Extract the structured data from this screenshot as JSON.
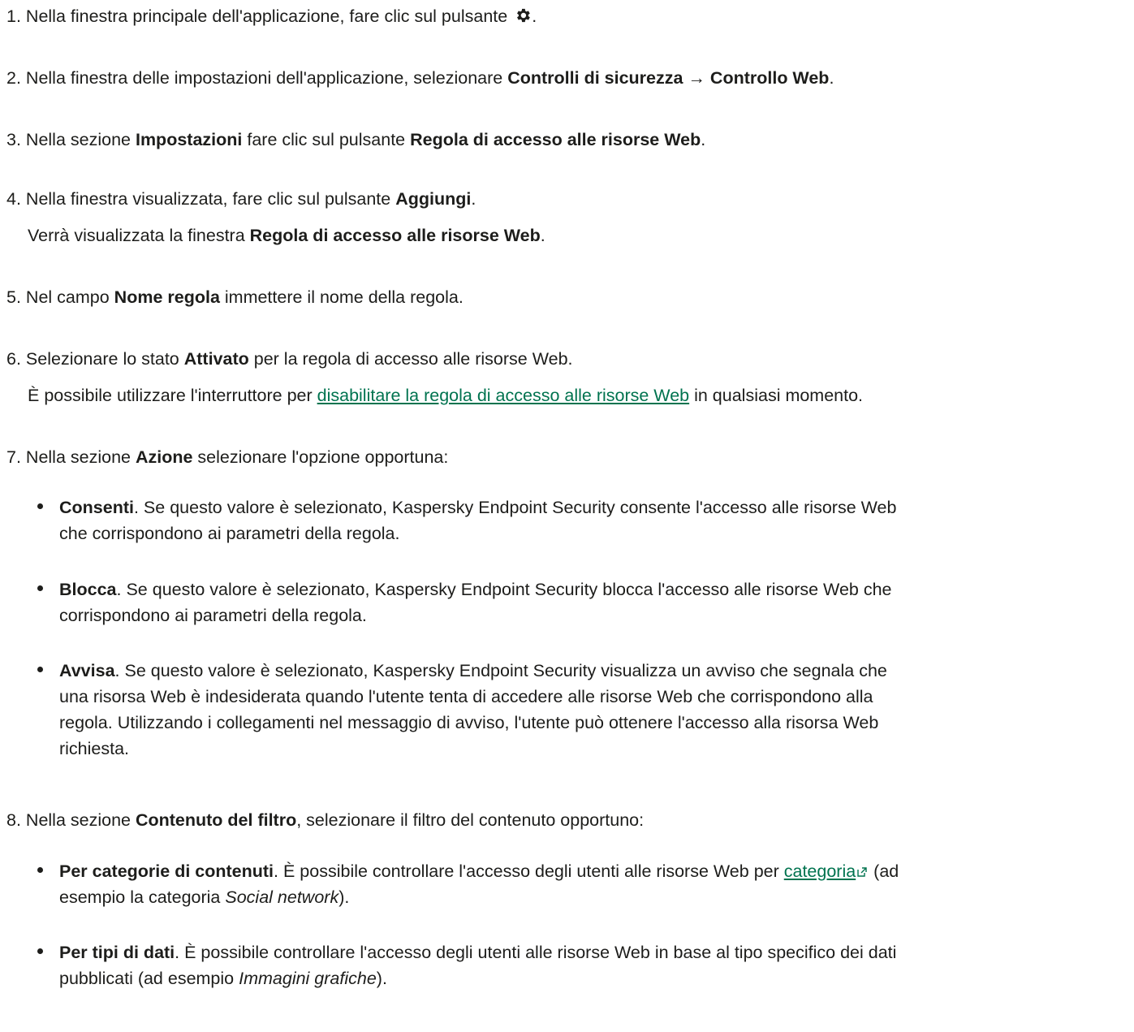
{
  "steps": {
    "s1": {
      "num": "1.",
      "text": "Nella finestra principale dell'applicazione, fare clic sul pulsante",
      "icon": "gear-icon",
      "after": "."
    },
    "s2": {
      "num": "2.",
      "pre": "Nella finestra delle impostazioni dell'applicazione, selezionare ",
      "bold1": "Controlli di sicurezza",
      "arrow": " → ",
      "bold2": "Controllo Web",
      "after": "."
    },
    "s3": {
      "num": "3.",
      "pre": "Nella sezione ",
      "bold1": "Impostazioni",
      "mid": " fare clic sul pulsante ",
      "bold2": "Regola di accesso alle risorse Web",
      "after": "."
    },
    "s4": {
      "num": "4.",
      "pre": "Nella finestra visualizzata, fare clic sul pulsante ",
      "bold1": "Aggiungi",
      "after": ".",
      "sub_pre": "Verrà visualizzata la finestra ",
      "sub_bold": "Regola di accesso alle risorse Web",
      "sub_after": "."
    },
    "s5": {
      "num": "5.",
      "pre": "Nel campo ",
      "bold1": "Nome regola",
      "after": " immettere il nome della regola."
    },
    "s6": {
      "num": "6.",
      "pre": "Selezionare lo stato ",
      "bold1": "Attivato",
      "after": " per la regola di accesso alle risorse Web.",
      "sub_pre": "È possibile utilizzare l'interruttore per ",
      "sub_link": "disabilitare la regola di accesso alle risorse Web",
      "sub_after": " in qualsiasi momento."
    },
    "s7": {
      "num": "7.",
      "pre": "Nella sezione ",
      "bold1": "Azione",
      "after": " selezionare l'opzione opportuna:",
      "bullets": [
        {
          "bold": "Consenti",
          "line1": ". Se questo valore è selezionato, Kaspersky Endpoint Security consente l'accesso alle risorse Web",
          "line2": "che corrispondono ai parametri della regola."
        },
        {
          "bold": "Blocca",
          "line1": ". Se questo valore è selezionato, Kaspersky Endpoint Security blocca l'accesso alle risorse Web che",
          "line2": "corrispondono ai parametri della regola."
        },
        {
          "bold": "Avvisa",
          "line1": ". Se questo valore è selezionato, Kaspersky Endpoint Security visualizza un avviso che segnala che",
          "line2": "una risorsa Web è indesiderata quando l'utente tenta di accedere alle risorse Web che corrispondono alla",
          "line3": "regola. Utilizzando i collegamenti nel messaggio di avviso, l'utente può ottenere l'accesso alla risorsa Web",
          "line4": "richiesta."
        }
      ]
    },
    "s8": {
      "num": "8.",
      "pre": "Nella sezione ",
      "bold1": "Contenuto del filtro",
      "after": ", selezionare il filtro del contenuto opportuno:",
      "bullets": [
        {
          "bold": "Per categorie di contenuti",
          "line1": ". È possibile controllare l'accesso degli utenti alle risorse Web per ",
          "link": "categoria",
          "link_icon": "external-link-icon",
          "line1_after": " (ad",
          "line2_pre": "esempio la categoria ",
          "line2_italic": "Social network",
          "line2_after": ")."
        },
        {
          "bold": "Per tipi di dati",
          "line1": ". È possibile controllare l'accesso degli utenti alle risorse Web in base al tipo specifico dei dati",
          "line2_pre": "pubblicati (ad esempio ",
          "line2_italic": "Immagini grafiche",
          "line2_after": ")."
        }
      ]
    }
  }
}
